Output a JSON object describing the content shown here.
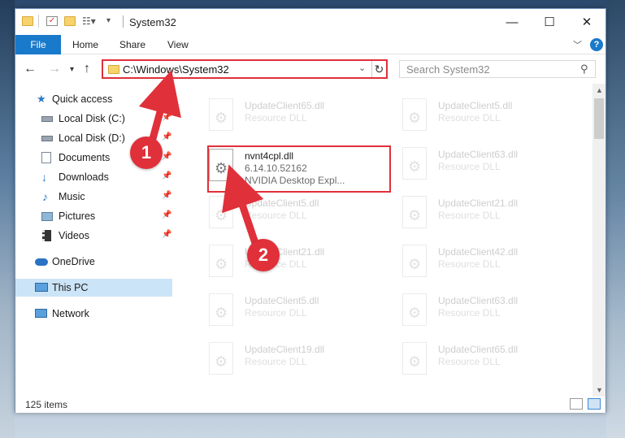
{
  "window": {
    "title": "System32"
  },
  "ribbon": {
    "tabs": [
      "File",
      "Home",
      "Share",
      "View"
    ],
    "help_label": "?"
  },
  "nav": {
    "address": "C:\\Windows\\System32",
    "search_placeholder": "Search System32"
  },
  "sidebar": {
    "items": [
      {
        "label": "Quick access",
        "icon": "star-icon",
        "pinned": false
      },
      {
        "label": "Local Disk (C:)",
        "icon": "drive-icon",
        "pinned": true
      },
      {
        "label": "Local Disk (D:)",
        "icon": "drive-icon",
        "pinned": true
      },
      {
        "label": "Documents",
        "icon": "documents-icon",
        "pinned": true
      },
      {
        "label": "Downloads",
        "icon": "download-icon",
        "pinned": true
      },
      {
        "label": "Music",
        "icon": "music-icon",
        "pinned": true
      },
      {
        "label": "Pictures",
        "icon": "pictures-icon",
        "pinned": true
      },
      {
        "label": "Videos",
        "icon": "videos-icon",
        "pinned": true
      },
      {
        "label": "OneDrive",
        "icon": "cloud-icon",
        "pinned": false
      },
      {
        "label": "This PC",
        "icon": "computer-icon",
        "pinned": false,
        "selected": true
      },
      {
        "label": "Network",
        "icon": "network-icon",
        "pinned": false
      }
    ]
  },
  "files": {
    "highlighted": {
      "name": "nvnt4cpl.dll",
      "version": "6.14.10.52162",
      "description": "NVIDIA Desktop Expl..."
    },
    "faded": [
      {
        "name": "UpdateClient65.dll",
        "type": "Resource DLL"
      },
      {
        "name": "UpdateClient5.dll",
        "type": "Resource DLL"
      },
      {
        "name": "UpdateClient63.dll",
        "type": "Resource DLL"
      },
      {
        "name": "UpdateClient5.dll",
        "type": "Resource DLL"
      },
      {
        "name": "UpdateClient21.dll",
        "type": "Resource DLL"
      },
      {
        "name": "UpdateClient21.dll",
        "type": "Resource DLL"
      },
      {
        "name": "UpdateClient42.dll",
        "type": "Resource DLL"
      },
      {
        "name": "UpdateClient5.dll",
        "type": "Resource DLL"
      },
      {
        "name": "UpdateClient63.dll",
        "type": "Resource DLL"
      },
      {
        "name": "UpdateClient19.dll",
        "type": "Resource DLL"
      },
      {
        "name": "UpdateClient65.dll",
        "type": "Resource DLL"
      }
    ]
  },
  "status": {
    "item_count": "125 items"
  },
  "annotations": {
    "step1": "1",
    "step2": "2",
    "color": "#e0303a"
  }
}
